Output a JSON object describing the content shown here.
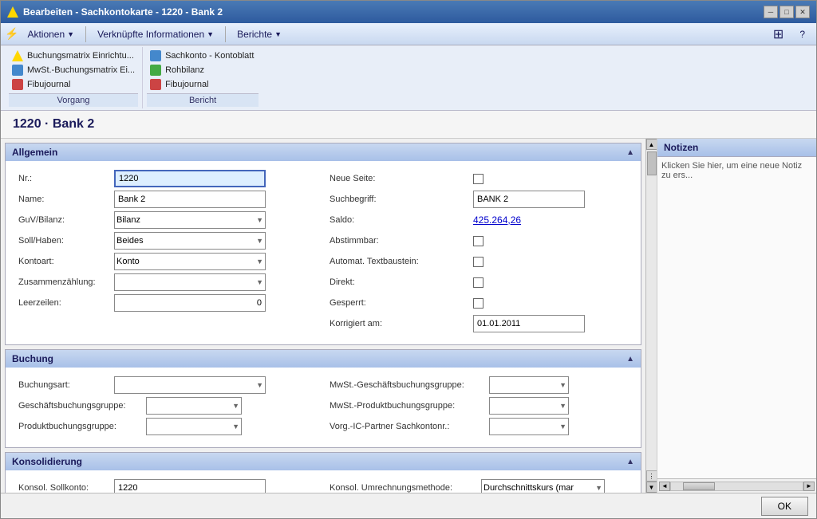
{
  "window": {
    "title": "Bearbeiten - Sachkontokarte - 1220 - Bank 2",
    "min_btn": "─",
    "max_btn": "□",
    "close_btn": "✕"
  },
  "menubar": {
    "lightning": "⚡",
    "aktionen": "Aktionen",
    "verknupfte": "Verknüpfte Informationen",
    "berichte": "Berichte"
  },
  "toolbar": {
    "vorgang_label": "Vorgang",
    "bericht_label": "Bericht",
    "btn1": "Buchungsmatrix Einrichtu...",
    "btn2": "MwSt.-Buchungsmatrix Ei...",
    "btn3": "Fibujournal",
    "btn4": "Sachkonto - Kontoblatt",
    "btn5": "Rohbilanz",
    "btn6": "Fibujournal"
  },
  "page_title": "1220 · Bank 2",
  "sections": {
    "allgemein": {
      "label": "Allgemein",
      "fields": {
        "nr_label": "Nr.:",
        "nr_value": "1220",
        "name_label": "Name:",
        "name_value": "Bank 2",
        "guv_label": "GuV/Bilanz:",
        "guv_value": "Bilanz",
        "soll_label": "Soll/Haben:",
        "soll_value": "Beides",
        "kontoart_label": "Kontoart:",
        "kontoart_value": "Konto",
        "zusammen_label": "Zusammenzählung:",
        "zusammen_value": "",
        "leerzeilen_label": "Leerzeilen:",
        "leerzeilen_value": "0",
        "neue_seite_label": "Neue Seite:",
        "suchbegriff_label": "Suchbegriff:",
        "suchbegriff_value": "BANK 2",
        "saldo_label": "Saldo:",
        "saldo_value": "425.264,26",
        "abstimmbar_label": "Abstimmbar:",
        "automat_label": "Automat. Textbaustein:",
        "direkt_label": "Direkt:",
        "gesperrt_label": "Gesperrt:",
        "korrigiert_label": "Korrigiert am:",
        "korrigiert_value": "01.01.2011"
      }
    },
    "buchung": {
      "label": "Buchung",
      "fields": {
        "buchungsart_label": "Buchungsart:",
        "buchungsart_value": "",
        "geschaeft_label": "Geschäftsbuchungsgruppe:",
        "geschaeft_value": "",
        "produkt_label": "Produktbuchungsgruppe:",
        "produkt_value": "",
        "mwst_geschaeft_label": "MwSt.-Geschäftsbuchungsgruppe:",
        "mwst_geschaeft_value": "",
        "mwst_produkt_label": "MwSt.-Produktbuchungsgruppe:",
        "mwst_produkt_value": "",
        "vorg_label": "Vorg.-IC-Partner Sachkontonr.:",
        "vorg_value": ""
      }
    },
    "konsolidierung": {
      "label": "Konsolidierung",
      "fields": {
        "konsol_soll_label": "Konsol. Sollkonto:",
        "konsol_soll_value": "1220",
        "konsol_umr_label": "Konsol. Umrechnungsmethode:",
        "konsol_umr_value": "Durchschnittskurs (mar"
      }
    }
  },
  "notizen": {
    "label": "Notizen",
    "placeholder": "Klicken Sie hier, um eine neue Notiz zu ers..."
  },
  "bottom": {
    "ok_label": "OK"
  }
}
